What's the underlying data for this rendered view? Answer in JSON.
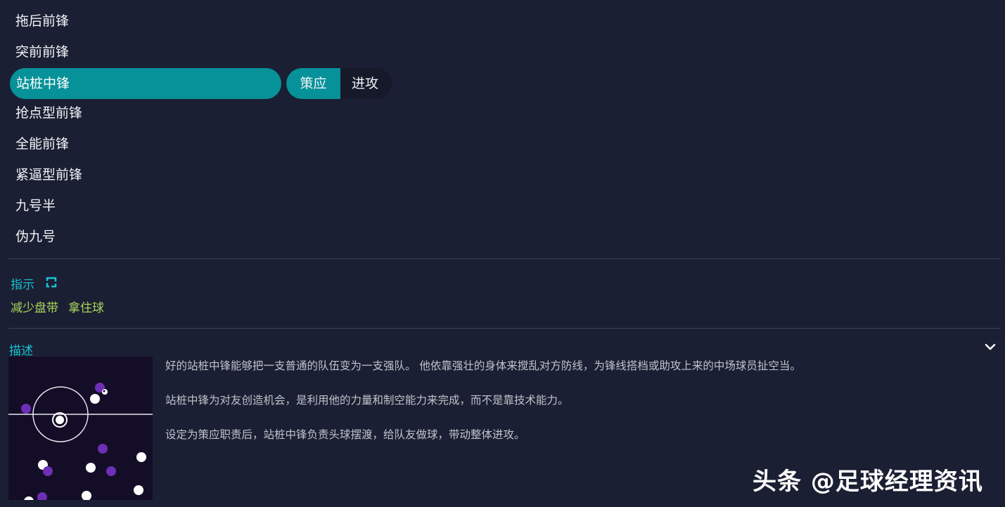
{
  "roles": [
    {
      "label": "拖后前锋"
    },
    {
      "label": "突前前锋"
    },
    {
      "label": "站桩中锋",
      "selected": true
    },
    {
      "label": "抢点型前锋"
    },
    {
      "label": "全能前锋"
    },
    {
      "label": "紧逼型前锋"
    },
    {
      "label": "九号半"
    },
    {
      "label": "伪九号"
    }
  ],
  "duty": {
    "active": "策应",
    "inactive": "进攻"
  },
  "instructions": {
    "title": "指示",
    "icon": "external-link-icon",
    "chips": [
      "减少盘带",
      "拿住球"
    ]
  },
  "description": {
    "title": "描述",
    "toggle_icon": "chevron-down-icon",
    "paragraphs": [
      "好的站桩中锋能够把一支普通的队伍变为一支强队。 他依靠强壮的身体来搅乱对方防线，为锋线搭档或助攻上来的中场球员扯空当。",
      "站桩中锋为对友创造机会，是利用他的力量和制空能力来完成，而不是靠技术能力。",
      "设定为策应职责后，站桩中锋负责头球摆渡，给队友做球，带动整体进攻。"
    ]
  },
  "colors": {
    "accent": "#079199",
    "section_title": "#17c3d3",
    "chip": "#a8d65c",
    "team_purple": "#6d2fb5",
    "team_white": "#ffffff"
  },
  "watermark": "头条 @足球经理资讯"
}
